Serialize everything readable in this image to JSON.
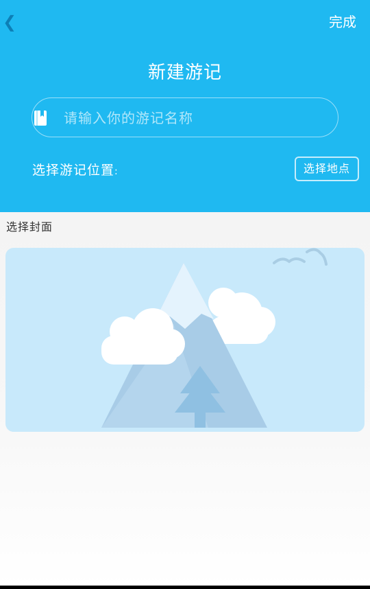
{
  "header": {
    "back_icon": "chevron-left-icon",
    "back_glyph": "❮",
    "done_label": "完成",
    "title": "新建游记",
    "background_color": "#1fb9f1"
  },
  "name_input": {
    "icon": "book-icon",
    "placeholder": "请输入你的游记名称",
    "value": ""
  },
  "location": {
    "label": "选择游记位置",
    "colon": ":",
    "button_label": "选择地点"
  },
  "cover": {
    "label": "选择封面",
    "placeholder_image": "mountain-placeholder-icon"
  }
}
